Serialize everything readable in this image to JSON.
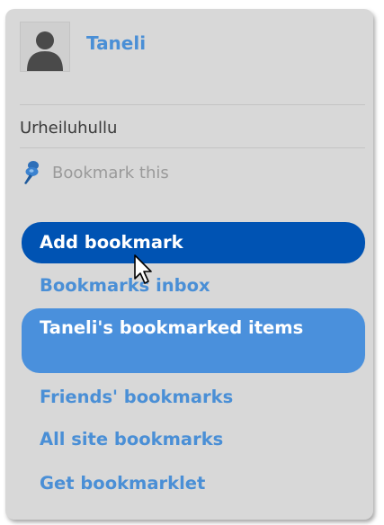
{
  "user": {
    "name": "Taneli",
    "avatar_icon": "user-silhouette-icon"
  },
  "group": {
    "name": "Urheiluhullu"
  },
  "bookmark_this": {
    "label": "Bookmark this",
    "icon": "pushpin-icon"
  },
  "menu": {
    "items": [
      {
        "label": "Add bookmark",
        "state": "hovered"
      },
      {
        "label": "Bookmarks inbox",
        "state": "normal"
      },
      {
        "label": "Taneli's bookmarked items",
        "state": "selected"
      },
      {
        "label": "Friends' bookmarks",
        "state": "normal"
      },
      {
        "label": "All site bookmarks",
        "state": "normal"
      },
      {
        "label": "Get bookmarklet",
        "state": "normal"
      }
    ]
  },
  "colors": {
    "panel_bg": "#d8d8d8",
    "link": "#4a8fd6",
    "hover_bg": "#0053b3",
    "selected_bg": "#4a90dc",
    "disabled_text": "#9a9a9a"
  }
}
